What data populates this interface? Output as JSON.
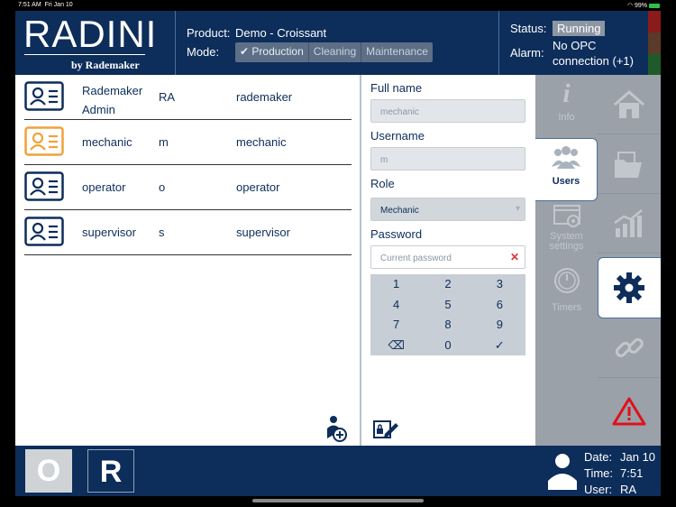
{
  "statusbar": {
    "time": "7:51 AM",
    "date": "Fri Jan 10",
    "battery": "99%"
  },
  "brand": {
    "logo": "RADINI",
    "byline": "by Rademaker"
  },
  "header": {
    "product_label": "Product:",
    "product_value": "Demo - Croissant",
    "mode_label": "Mode:",
    "modes": [
      "Production",
      "Cleaning",
      "Maintenance"
    ],
    "status_label": "Status:",
    "status_value": "Running",
    "alarm_label": "Alarm:",
    "alarm_value": "No OPC connection (+1)",
    "lamp_colors": [
      "#8b1a1a",
      "#5a3a2a",
      "#1f5a2a"
    ]
  },
  "users": [
    {
      "name": "Rademaker Admin",
      "initials": "RA",
      "login": "rademaker",
      "icon": "user-card-icon",
      "color": "#0d2d5a"
    },
    {
      "name": "mechanic",
      "initials": "m",
      "login": "mechanic",
      "icon": "user-card-icon",
      "color": "#f0a23a"
    },
    {
      "name": "operator",
      "initials": "o",
      "login": "operator",
      "icon": "user-card-icon",
      "color": "#0d2d5a"
    },
    {
      "name": "supervisor",
      "initials": "s",
      "login": "supervisor",
      "icon": "user-card-icon",
      "color": "#0d2d5a"
    }
  ],
  "form": {
    "fullname_label": "Full name",
    "fullname_value": "mechanic",
    "username_label": "Username",
    "username_value": "m",
    "role_label": "Role",
    "role_value": "Mechanic",
    "password_label": "Password",
    "password_placeholder": "Current password",
    "keys": [
      "1",
      "2",
      "3",
      "4",
      "5",
      "6",
      "7",
      "8",
      "9",
      "⌫",
      "0",
      "✓"
    ]
  },
  "tabs": [
    {
      "label": "Info",
      "icon": "info-icon"
    },
    {
      "label": "Users",
      "icon": "users-icon"
    },
    {
      "label": "System settings",
      "icon": "system-settings-icon"
    },
    {
      "label": "Timers",
      "icon": "timer-icon"
    }
  ],
  "rail": [
    "home-icon",
    "folder-icon",
    "chart-icon",
    "gear-icon",
    "link-icon",
    "warning-icon"
  ],
  "footer": {
    "btn_o": "O",
    "btn_r": "R",
    "date_label": "Date:",
    "date_value": "Jan 10",
    "time_label": "Time:",
    "time_value": "7:51",
    "user_label": "User:",
    "user_value": "RA"
  }
}
